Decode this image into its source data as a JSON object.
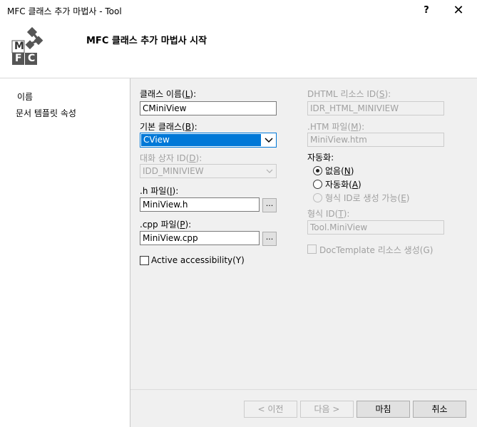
{
  "window": {
    "title": "MFC 클래스 추가 마법사 - Tool",
    "help": "?",
    "close": "✕"
  },
  "header": {
    "title": "MFC 클래스 추가 마법사 시작",
    "logo_letters": [
      "M",
      "F",
      "C"
    ]
  },
  "nav": {
    "items": [
      "이름",
      "문서 템플릿 속성"
    ]
  },
  "form": {
    "class_name_label": "클래스 이름(",
    "class_name_key": "L",
    "class_name_end": "):",
    "class_name_value": "CMiniView",
    "base_class_label": "기본 클래스(",
    "base_class_key": "B",
    "base_class_end": "):",
    "base_class_value": "CView",
    "dialog_id_label": "대화 상자 ID(",
    "dialog_id_key": "D",
    "dialog_id_end": "):",
    "dialog_id_value": "IDD_MINIVIEW",
    "h_file_label": ".h 파일(",
    "h_file_key": "I",
    "h_file_end": "):",
    "h_file_value": "MiniView.h",
    "cpp_file_label": ".cpp 파일(",
    "cpp_file_key": "P",
    "cpp_file_end": "):",
    "cpp_file_value": "MiniView.cpp",
    "browse_label": "...",
    "active_accessibility_label": "Active accessibility(Y)"
  },
  "right": {
    "dhtml_label": "DHTML 리소스 ID(",
    "dhtml_key": "S",
    "dhtml_end": "):",
    "dhtml_value": "IDR_HTML_MINIVIEW",
    "htm_label": ".HTM 파일(",
    "htm_key": "M",
    "htm_end": "):",
    "htm_value": "MiniView.htm",
    "automation_label": "자동화:",
    "radio_none": "없음(",
    "radio_none_key": "N",
    "radio_none_end": ")",
    "radio_auto": "자동화(",
    "radio_auto_key": "A",
    "radio_auto_end": ")",
    "radio_create": "형식 ID로 생성 가능(",
    "radio_create_key": "E",
    "radio_create_end": ")",
    "type_id_label": "형식 ID(",
    "type_id_key": "T",
    "type_id_end": "):",
    "type_id_value": "Tool.MiniView",
    "doctemplate_label": "DocTemplate 리소스 생성(G)"
  },
  "buttons": {
    "prev": "< 이전",
    "next": "다음 >",
    "finish": "마침",
    "cancel": "취소"
  }
}
